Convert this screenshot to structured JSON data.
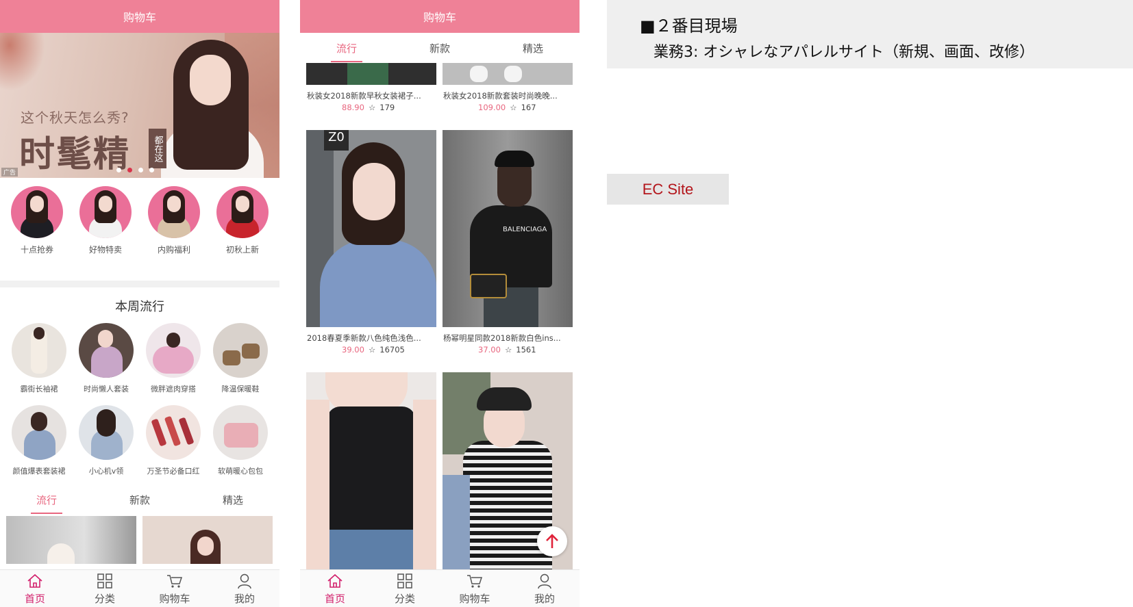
{
  "phone1": {
    "header_title": "购物车",
    "banner": {
      "subtitle": "这个秋天怎么秀?",
      "headline": "时髦精",
      "tag": "都在这",
      "ad_label": "广告",
      "dots": 4,
      "active_dot": 1
    },
    "categories": [
      {
        "label": "十点抢券"
      },
      {
        "label": "好物特卖"
      },
      {
        "label": "内购福利"
      },
      {
        "label": "初秋上新"
      }
    ],
    "weekly_title": "本周流行",
    "weekly_items": [
      {
        "label": "霸街长袖裙"
      },
      {
        "label": "时尚懒人套装"
      },
      {
        "label": "微胖遮肉穿搭"
      },
      {
        "label": "降温保暖鞋"
      },
      {
        "label": "颜值爆表套装裙"
      },
      {
        "label": "小心机v领"
      },
      {
        "label": "万圣节必备口红"
      },
      {
        "label": "软萌暖心包包"
      }
    ],
    "tabs": [
      "流行",
      "新款",
      "精选"
    ],
    "active_tab": "流行"
  },
  "phone2": {
    "header_title": "购物车",
    "tabs": [
      "流行",
      "新款",
      "精选"
    ],
    "active_tab": "流行",
    "products": [
      {
        "title": "秋装女2018新款早秋女装裙子...",
        "price": "88.90",
        "sales": "179"
      },
      {
        "title": "秋装女2018新款套装时尚晚晚...",
        "price": "109.00",
        "sales": "167"
      },
      {
        "title": "2018春夏季新款八色纯色浅色...",
        "price": "39.00",
        "sales": "16705"
      },
      {
        "title": "杨幂明星同款2018新款白色ins...",
        "price": "37.00",
        "sales": "1561"
      }
    ]
  },
  "tabbar": [
    {
      "label": "首页",
      "icon": "home-icon"
    },
    {
      "label": "分类",
      "icon": "grid-icon"
    },
    {
      "label": "购物车",
      "icon": "cart-icon"
    },
    {
      "label": "我的",
      "icon": "user-icon"
    }
  ],
  "note": {
    "heading": "■２番目現場",
    "subheading": "業務3: オシャレなアパレルサイト（新規、画面、改修）"
  },
  "ec_label": "EC Site",
  "colors": {
    "header_pink": "#ef8197",
    "accent_pink": "#e8667f",
    "tabbar_active": "#d21f6b",
    "ec_red": "#b3151b"
  }
}
